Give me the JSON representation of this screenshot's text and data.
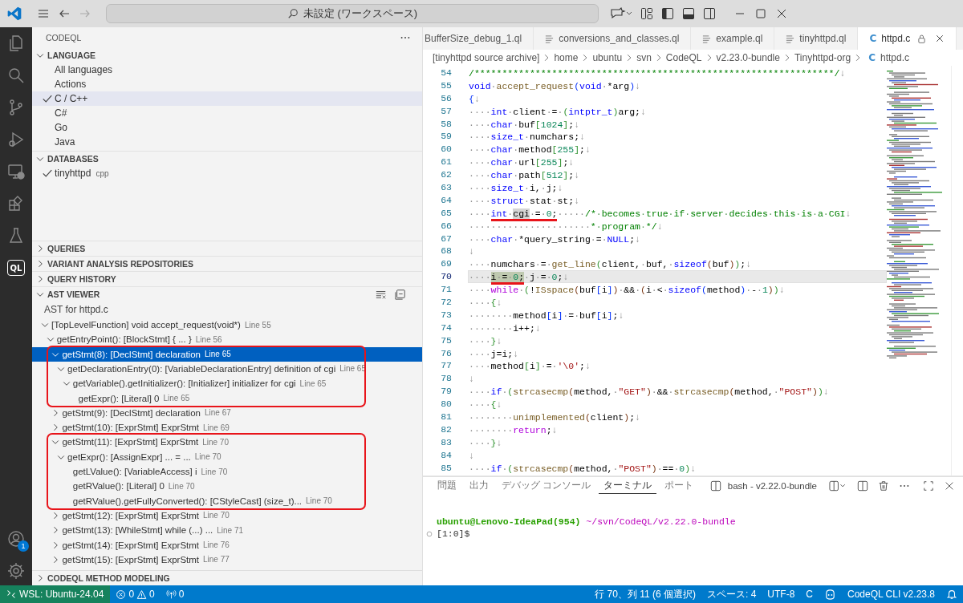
{
  "title_bar": {
    "search": "未設定 (ワークスペース)"
  },
  "activity_bar": {
    "items": [
      {
        "kind": "files",
        "selected": false
      },
      {
        "kind": "search",
        "selected": false
      },
      {
        "kind": "source-control",
        "selected": false
      },
      {
        "kind": "run",
        "selected": false
      },
      {
        "kind": "remote",
        "selected": false
      },
      {
        "kind": "extensions",
        "selected": false
      },
      {
        "kind": "testing",
        "selected": false
      },
      {
        "kind": "codeql",
        "label": "QL",
        "selected": true
      }
    ],
    "account_badge": "1"
  },
  "sidebar": {
    "title": "CODEQL",
    "sections": [
      {
        "title": "LANGUAGE",
        "kind": "languages",
        "expanded": true,
        "items": [
          {
            "label": "All languages",
            "checked": false,
            "selected": false
          },
          {
            "label": "Actions",
            "checked": false,
            "selected": false
          },
          {
            "label": "C / C++",
            "checked": true,
            "selected": true
          },
          {
            "label": "C#",
            "checked": false,
            "selected": false
          },
          {
            "label": "Go",
            "checked": false,
            "selected": false
          },
          {
            "label": "Java",
            "checked": false,
            "selected": false
          }
        ]
      },
      {
        "title": "DATABASES",
        "kind": "databases",
        "expanded": true,
        "items": [
          {
            "label": "tinyhttpd",
            "detail": "cpp",
            "checked": true,
            "selected": false
          }
        ]
      },
      {
        "title": "QUERIES",
        "kind": "queries",
        "expanded": false
      },
      {
        "title": "VARIANT ANALYSIS REPOSITORIES",
        "kind": "variant",
        "expanded": false
      },
      {
        "title": "QUERY HISTORY",
        "kind": "history",
        "expanded": false
      },
      {
        "title": "AST VIEWER",
        "kind": "ast",
        "expanded": true,
        "caption": "AST for httpd.c",
        "nodes": [
          {
            "label": "[TopLevelFunction] void accept_request(void*)",
            "line": "Line 55",
            "kind": "branch",
            "expanded": true,
            "selected": false,
            "children": [
              {
                "label": "getEntryPoint(): [BlockStmt] { ... }",
                "line": "Line 56",
                "kind": "branch",
                "expanded": true,
                "selected": false,
                "children": [
                  {
                    "label": "getStmt(8): [DeclStmt] declaration",
                    "line": "Line 65",
                    "kind": "branch",
                    "expanded": true,
                    "selected": true,
                    "annotated": true,
                    "children": [
                      {
                        "label": "getDeclarationEntry(0): [VariableDeclarationEntry] definition of cgi",
                        "line": "Line 65",
                        "kind": "branch",
                        "expanded": true,
                        "selected": false,
                        "children": [
                          {
                            "label": "getVariable().getInitializer(): [Initializer] initializer for cgi",
                            "line": "Line 65",
                            "kind": "branch",
                            "expanded": true,
                            "selected": false,
                            "children": [
                              {
                                "label": "getExpr(): [Literal] 0",
                                "line": "Line 65",
                                "kind": "leaf",
                                "selected": false
                              }
                            ]
                          }
                        ]
                      }
                    ]
                  },
                  {
                    "label": "getStmt(9): [DeclStmt] declaration",
                    "line": "Line 67",
                    "kind": "branch",
                    "expanded": false,
                    "selected": false
                  },
                  {
                    "label": "getStmt(10): [ExprStmt] ExprStmt",
                    "line": "Line 69",
                    "kind": "branch",
                    "expanded": false,
                    "selected": false
                  },
                  {
                    "label": "getStmt(11): [ExprStmt] ExprStmt",
                    "line": "Line 70",
                    "kind": "branch",
                    "expanded": true,
                    "selected": false,
                    "annotated": true,
                    "children": [
                      {
                        "label": "getExpr(): [AssignExpr] ... = ...",
                        "line": "Line 70",
                        "kind": "branch",
                        "expanded": true,
                        "selected": false,
                        "children": [
                          {
                            "label": "getLValue(): [VariableAccess] i",
                            "line": "Line 70",
                            "kind": "leaf",
                            "selected": false
                          },
                          {
                            "label": "getRValue(): [Literal] 0",
                            "line": "Line 70",
                            "kind": "leaf",
                            "selected": false
                          },
                          {
                            "label": "getRValue().getFullyConverted(): [CStyleCast] (size_t)...",
                            "line": "Line 70",
                            "kind": "leaf",
                            "selected": false
                          }
                        ]
                      }
                    ]
                  },
                  {
                    "label": "getStmt(12): [ExprStmt] ExprStmt",
                    "line": "Line 70",
                    "kind": "branch",
                    "expanded": false,
                    "selected": false
                  },
                  {
                    "label": "getStmt(13): [WhileStmt] while (...) ...",
                    "line": "Line 71",
                    "kind": "branch",
                    "expanded": false,
                    "selected": false
                  },
                  {
                    "label": "getStmt(14): [ExprStmt] ExprStmt",
                    "line": "Line 76",
                    "kind": "branch",
                    "expanded": false,
                    "selected": false
                  },
                  {
                    "label": "getStmt(15): [ExprStmt] ExprStmt",
                    "line": "Line 77",
                    "kind": "branch",
                    "expanded": false,
                    "selected": false
                  }
                ]
              }
            ]
          }
        ]
      },
      {
        "title": "CODEQL METHOD MODELING",
        "kind": "modeling",
        "expanded": false
      }
    ]
  },
  "editor": {
    "tabs": [
      {
        "label": "BufferSize_debug_1.ql",
        "kind": "partial",
        "selected": false
      },
      {
        "label": "conversions_and_classes.ql",
        "kind": "ql",
        "selected": false
      },
      {
        "label": "example.ql",
        "kind": "ql",
        "selected": false
      },
      {
        "label": "tinyhttpd.ql",
        "kind": "ql",
        "selected": false
      },
      {
        "label": "httpd.c",
        "kind": "c",
        "icon": "C",
        "selected": true,
        "readonly": true
      }
    ],
    "breadcrumbs": [
      {
        "label": "[tinyhttpd source archive]"
      },
      {
        "label": "home"
      },
      {
        "label": "ubuntu"
      },
      {
        "label": "svn"
      },
      {
        "label": "CodeQL"
      },
      {
        "label": "v2.23.0-bundle"
      },
      {
        "label": "Tinyhttpd-org"
      },
      {
        "label": "httpd.c",
        "icon": "C"
      }
    ],
    "lines": [
      {
        "n": "54",
        "current": false,
        "tokens": [
          {
            "text": "/*****************************************************************/",
            "kind": "comment"
          },
          {
            "text": "↓",
            "kind": "eol"
          }
        ]
      },
      {
        "n": "55",
        "current": false,
        "tokens": [
          {
            "text": "void·",
            "kind": "keyword"
          },
          {
            "text": "accept_request",
            "kind": "function"
          },
          {
            "text": "(",
            "kind": "bracket1"
          },
          {
            "text": "void·",
            "kind": "keyword"
          },
          {
            "text": "*arg",
            "kind": "plain"
          },
          {
            "text": ")",
            "kind": "bracket1"
          },
          {
            "text": "↓",
            "kind": "eol"
          }
        ]
      },
      {
        "n": "56",
        "current": false,
        "tokens": [
          {
            "text": "{",
            "kind": "bracket1"
          },
          {
            "text": "↓",
            "kind": "eol"
          }
        ]
      },
      {
        "n": "57",
        "current": false,
        "tokens": [
          {
            "text": "····int·",
            "kind": "keyword"
          },
          {
            "text": "client·=·",
            "kind": "plain"
          },
          {
            "text": "(",
            "kind": "bracket2"
          },
          {
            "text": "intptr_t",
            "kind": "keyword"
          },
          {
            "text": ")",
            "kind": "bracket2"
          },
          {
            "text": "arg;",
            "kind": "plain"
          },
          {
            "text": "↓",
            "kind": "eol"
          }
        ]
      },
      {
        "n": "58",
        "current": false,
        "tokens": [
          {
            "text": "····char·",
            "kind": "keyword"
          },
          {
            "text": "buf",
            "kind": "plain"
          },
          {
            "text": "[",
            "kind": "bracket2"
          },
          {
            "text": "1024",
            "kind": "number"
          },
          {
            "text": "]",
            "kind": "bracket2"
          },
          {
            "text": ";",
            "kind": "plain"
          },
          {
            "text": "↓",
            "kind": "eol"
          }
        ]
      },
      {
        "n": "59",
        "current": false,
        "tokens": [
          {
            "text": "····size_t·",
            "kind": "keyword"
          },
          {
            "text": "numchars;",
            "kind": "plain"
          },
          {
            "text": "↓",
            "kind": "eol"
          }
        ]
      },
      {
        "n": "60",
        "current": false,
        "tokens": [
          {
            "text": "····char·",
            "kind": "keyword"
          },
          {
            "text": "method",
            "kind": "plain"
          },
          {
            "text": "[",
            "kind": "bracket2"
          },
          {
            "text": "255",
            "kind": "number"
          },
          {
            "text": "]",
            "kind": "bracket2"
          },
          {
            "text": ";",
            "kind": "plain"
          },
          {
            "text": "↓",
            "kind": "eol"
          }
        ]
      },
      {
        "n": "61",
        "current": false,
        "tokens": [
          {
            "text": "····char·",
            "kind": "keyword"
          },
          {
            "text": "url",
            "kind": "plain"
          },
          {
            "text": "[",
            "kind": "bracket2"
          },
          {
            "text": "255",
            "kind": "number"
          },
          {
            "text": "]",
            "kind": "bracket2"
          },
          {
            "text": ";",
            "kind": "plain"
          },
          {
            "text": "↓",
            "kind": "eol"
          }
        ]
      },
      {
        "n": "62",
        "current": false,
        "tokens": [
          {
            "text": "····char·",
            "kind": "keyword"
          },
          {
            "text": "path",
            "kind": "plain"
          },
          {
            "text": "[",
            "kind": "bracket2"
          },
          {
            "text": "512",
            "kind": "number"
          },
          {
            "text": "]",
            "kind": "bracket2"
          },
          {
            "text": ";",
            "kind": "plain"
          },
          {
            "text": "↓",
            "kind": "eol"
          }
        ]
      },
      {
        "n": "63",
        "current": false,
        "tokens": [
          {
            "text": "····size_t·",
            "kind": "keyword"
          },
          {
            "text": "i,·j;",
            "kind": "plain"
          },
          {
            "text": "↓",
            "kind": "eol"
          }
        ]
      },
      {
        "n": "64",
        "current": false,
        "tokens": [
          {
            "text": "····struct·",
            "kind": "keyword"
          },
          {
            "text": "stat·st;",
            "kind": "plain"
          },
          {
            "text": "↓",
            "kind": "eol"
          }
        ]
      },
      {
        "n": "65",
        "current": false,
        "tokens": [
          {
            "text": "····",
            "kind": "plain"
          },
          {
            "kind": "group",
            "underline": true,
            "selected": false,
            "tokens": [
              {
                "text": "int·",
                "kind": "keyword"
              },
              {
                "text": "cgi",
                "kind": "plain",
                "highlighted": true
              },
              {
                "text": "·=·",
                "kind": "plain"
              },
              {
                "text": "0",
                "kind": "number"
              },
              {
                "text": ";",
                "kind": "plain"
              }
            ]
          },
          {
            "text": "·····",
            "kind": "plain"
          },
          {
            "text": "/*·becomes·true·if·server·decides·this·is·a·CGI",
            "kind": "comment"
          },
          {
            "text": "↓",
            "kind": "eol"
          }
        ]
      },
      {
        "n": "66",
        "current": false,
        "tokens": [
          {
            "text": "······················",
            "kind": "plain"
          },
          {
            "text": "*·program·*/",
            "kind": "comment"
          },
          {
            "text": "↓",
            "kind": "eol"
          }
        ]
      },
      {
        "n": "67",
        "current": false,
        "tokens": [
          {
            "text": "····char·",
            "kind": "keyword"
          },
          {
            "text": "*query_string·=·",
            "kind": "plain"
          },
          {
            "text": "NULL",
            "kind": "keyword"
          },
          {
            "text": ";",
            "kind": "plain"
          },
          {
            "text": "↓",
            "kind": "eol"
          }
        ]
      },
      {
        "n": "68",
        "current": false,
        "tokens": [
          {
            "text": "↓",
            "kind": "eol"
          }
        ]
      },
      {
        "n": "69",
        "current": false,
        "tokens": [
          {
            "text": "····numchars·=·",
            "kind": "plain"
          },
          {
            "text": "get_line",
            "kind": "function"
          },
          {
            "text": "(",
            "kind": "bracket2"
          },
          {
            "text": "client,·buf,·",
            "kind": "plain"
          },
          {
            "text": "sizeof",
            "kind": "keyword"
          },
          {
            "text": "(",
            "kind": "bracket3"
          },
          {
            "text": "buf",
            "kind": "plain"
          },
          {
            "text": ")",
            "kind": "bracket3"
          },
          {
            "text": ")",
            "kind": "bracket2"
          },
          {
            "text": ";",
            "kind": "plain"
          },
          {
            "text": "↓",
            "kind": "eol"
          }
        ]
      },
      {
        "n": "70",
        "current": true,
        "tokens": [
          {
            "text": "····",
            "kind": "plain"
          },
          {
            "kind": "group",
            "underline": true,
            "selected": true,
            "tokens": [
              {
                "text": "i·=·",
                "kind": "plain"
              },
              {
                "text": "0",
                "kind": "number"
              },
              {
                "text": ";",
                "kind": "plain"
              }
            ]
          },
          {
            "text": "·j·=·",
            "kind": "plain"
          },
          {
            "text": "0",
            "kind": "number"
          },
          {
            "text": ";",
            "kind": "plain"
          },
          {
            "text": "↓",
            "kind": "eol"
          }
        ]
      },
      {
        "n": "71",
        "current": false,
        "tokens": [
          {
            "text": "····while·",
            "kind": "control"
          },
          {
            "text": "(",
            "kind": "bracket2"
          },
          {
            "text": "!",
            "kind": "plain"
          },
          {
            "text": "ISspace",
            "kind": "function"
          },
          {
            "text": "(",
            "kind": "bracket3"
          },
          {
            "text": "buf",
            "kind": "plain"
          },
          {
            "text": "[",
            "kind": "bracket1"
          },
          {
            "text": "i",
            "kind": "plain"
          },
          {
            "text": "]",
            "kind": "bracket1"
          },
          {
            "text": ")",
            "kind": "bracket3"
          },
          {
            "text": "·&&·",
            "kind": "plain"
          },
          {
            "text": "(",
            "kind": "bracket3"
          },
          {
            "text": "i·<·",
            "kind": "plain"
          },
          {
            "text": "sizeof",
            "kind": "keyword"
          },
          {
            "text": "(",
            "kind": "bracket1"
          },
          {
            "text": "method",
            "kind": "plain"
          },
          {
            "text": ")",
            "kind": "bracket1"
          },
          {
            "text": "·-·",
            "kind": "plain"
          },
          {
            "text": "1",
            "kind": "number"
          },
          {
            "text": ")",
            "kind": "bracket3"
          },
          {
            "text": ")",
            "kind": "bracket2"
          },
          {
            "text": "↓",
            "kind": "eol"
          }
        ]
      },
      {
        "n": "72",
        "current": false,
        "tokens": [
          {
            "text": "····{",
            "kind": "bracket2"
          },
          {
            "text": "↓",
            "kind": "eol"
          }
        ]
      },
      {
        "n": "73",
        "current": false,
        "tokens": [
          {
            "text": "········method",
            "kind": "plain"
          },
          {
            "text": "[",
            "kind": "bracket1"
          },
          {
            "text": "i",
            "kind": "plain"
          },
          {
            "text": "]",
            "kind": "bracket1"
          },
          {
            "text": "·=·buf",
            "kind": "plain"
          },
          {
            "text": "[",
            "kind": "bracket1"
          },
          {
            "text": "i",
            "kind": "plain"
          },
          {
            "text": "]",
            "kind": "bracket1"
          },
          {
            "text": ";",
            "kind": "plain"
          },
          {
            "text": "↓",
            "kind": "eol"
          }
        ]
      },
      {
        "n": "74",
        "current": false,
        "tokens": [
          {
            "text": "········i++;",
            "kind": "plain"
          },
          {
            "text": "↓",
            "kind": "eol"
          }
        ]
      },
      {
        "n": "75",
        "current": false,
        "tokens": [
          {
            "text": "····}",
            "kind": "bracket2"
          },
          {
            "text": "↓",
            "kind": "eol"
          }
        ]
      },
      {
        "n": "76",
        "current": false,
        "tokens": [
          {
            "text": "····j=i;",
            "kind": "plain"
          },
          {
            "text": "↓",
            "kind": "eol"
          }
        ]
      },
      {
        "n": "77",
        "current": false,
        "tokens": [
          {
            "text": "····method",
            "kind": "plain"
          },
          {
            "text": "[",
            "kind": "bracket2"
          },
          {
            "text": "i",
            "kind": "plain"
          },
          {
            "text": "]",
            "kind": "bracket2"
          },
          {
            "text": "·=·",
            "kind": "plain"
          },
          {
            "text": "'\\0'",
            "kind": "string"
          },
          {
            "text": ";",
            "kind": "plain"
          },
          {
            "text": "↓",
            "kind": "eol"
          }
        ]
      },
      {
        "n": "78",
        "current": false,
        "tokens": [
          {
            "text": "↓",
            "kind": "eol"
          }
        ]
      },
      {
        "n": "79",
        "current": false,
        "tokens": [
          {
            "text": "····if·",
            "kind": "keyword"
          },
          {
            "text": "(",
            "kind": "bracket2"
          },
          {
            "text": "strcasecmp",
            "kind": "function"
          },
          {
            "text": "(",
            "kind": "bracket3"
          },
          {
            "text": "method,·",
            "kind": "plain"
          },
          {
            "text": "\"GET\"",
            "kind": "string"
          },
          {
            "text": ")",
            "kind": "bracket3"
          },
          {
            "text": "·&&·",
            "kind": "plain"
          },
          {
            "text": "strcasecmp",
            "kind": "function"
          },
          {
            "text": "(",
            "kind": "bracket3"
          },
          {
            "text": "method,·",
            "kind": "plain"
          },
          {
            "text": "\"POST\"",
            "kind": "string"
          },
          {
            "text": ")",
            "kind": "bracket3"
          },
          {
            "text": ")",
            "kind": "bracket2"
          },
          {
            "text": "↓",
            "kind": "eol"
          }
        ]
      },
      {
        "n": "80",
        "current": false,
        "tokens": [
          {
            "text": "····{",
            "kind": "bracket2"
          },
          {
            "text": "↓",
            "kind": "eol"
          }
        ]
      },
      {
        "n": "81",
        "current": false,
        "tokens": [
          {
            "text": "········unimplemented",
            "kind": "function"
          },
          {
            "text": "(",
            "kind": "bracket3"
          },
          {
            "text": "client",
            "kind": "plain"
          },
          {
            "text": ")",
            "kind": "bracket3"
          },
          {
            "text": ";",
            "kind": "plain"
          },
          {
            "text": "↓",
            "kind": "eol"
          }
        ]
      },
      {
        "n": "82",
        "current": false,
        "tokens": [
          {
            "text": "········return",
            "kind": "control"
          },
          {
            "text": ";",
            "kind": "plain"
          },
          {
            "text": "↓",
            "kind": "eol"
          }
        ]
      },
      {
        "n": "83",
        "current": false,
        "tokens": [
          {
            "text": "····}",
            "kind": "bracket2"
          },
          {
            "text": "↓",
            "kind": "eol"
          }
        ]
      },
      {
        "n": "84",
        "current": false,
        "tokens": [
          {
            "text": "↓",
            "kind": "eol"
          }
        ]
      },
      {
        "n": "85",
        "current": false,
        "tokens": [
          {
            "text": "····if·",
            "kind": "keyword"
          },
          {
            "text": "(",
            "kind": "bracket2"
          },
          {
            "text": "strcasecmp",
            "kind": "function"
          },
          {
            "text": "(",
            "kind": "bracket3"
          },
          {
            "text": "method,·",
            "kind": "plain"
          },
          {
            "text": "\"POST\"",
            "kind": "string"
          },
          {
            "text": ")",
            "kind": "bracket3"
          },
          {
            "text": "·==·",
            "kind": "plain"
          },
          {
            "text": "0",
            "kind": "number"
          },
          {
            "text": ")",
            "kind": "bracket2"
          },
          {
            "text": "↓",
            "kind": "eol"
          }
        ]
      }
    ]
  },
  "panel": {
    "tabs": [
      {
        "label": "問題",
        "selected": false
      },
      {
        "label": "出力",
        "selected": false
      },
      {
        "label": "デバッグ コンソール",
        "selected": false
      },
      {
        "label": "ターミナル",
        "selected": true
      },
      {
        "label": "ポート",
        "selected": false
      }
    ],
    "terminal_name": "bash - v2.22.0-bundle",
    "lines": [
      {
        "marker": false,
        "segments": [
          {
            "text": "ubuntu@Lenovo-IdeaPad(954)",
            "kind": "user"
          },
          {
            "text": " ~/svn/CodeQL/v2.22.0-bundle",
            "kind": "path"
          }
        ]
      },
      {
        "marker": true,
        "segments": [
          {
            "text": "[1:0]$",
            "kind": "plain"
          }
        ]
      }
    ]
  },
  "status_bar": {
    "remote": "WSL: Ubuntu-24.04",
    "errors": "0",
    "warnings": "0",
    "ports": "0",
    "right": [
      {
        "kind": "text",
        "label": "行 70、列 11 (6 個選択)"
      },
      {
        "kind": "text",
        "label": "スペース: 4"
      },
      {
        "kind": "text",
        "label": "UTF-8"
      },
      {
        "kind": "text",
        "label": "C"
      },
      {
        "kind": "copilot"
      },
      {
        "kind": "text",
        "label": "CodeQL CLI v2.23.8"
      },
      {
        "kind": "bell"
      }
    ]
  }
}
